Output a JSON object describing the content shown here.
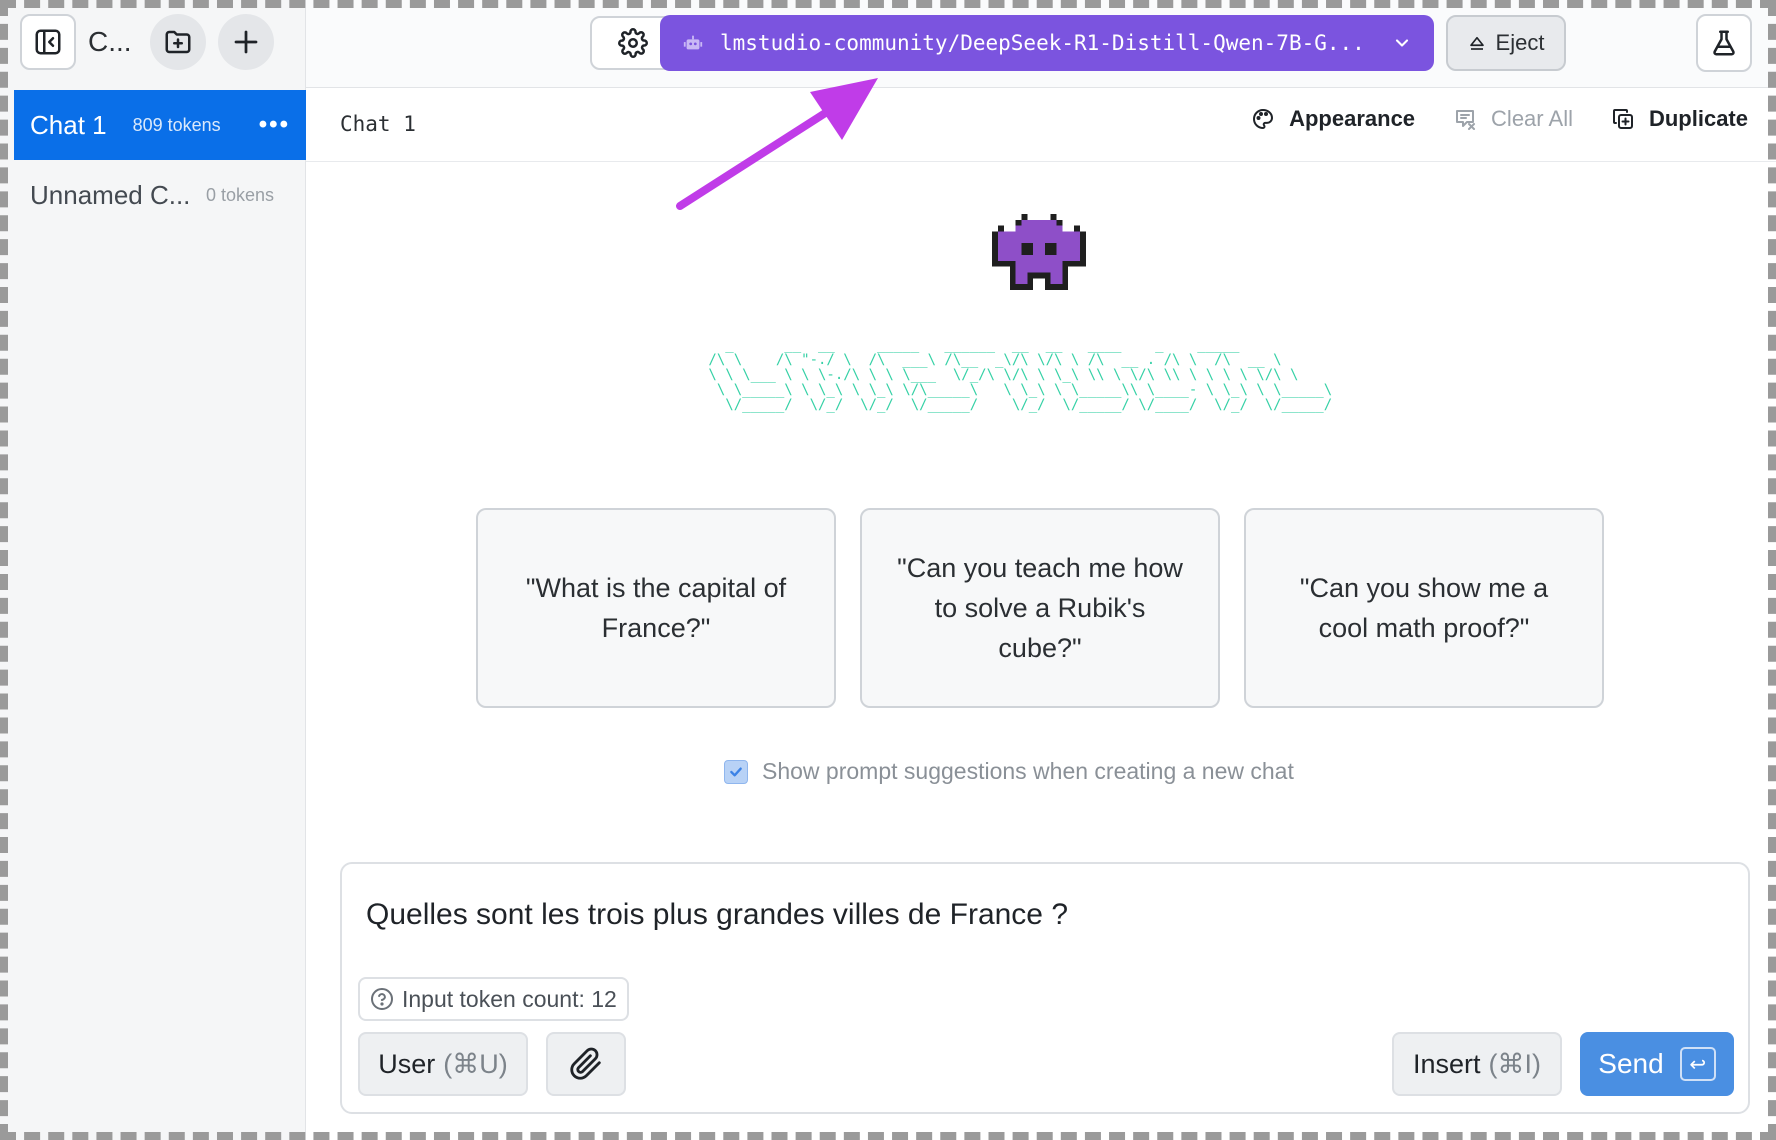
{
  "sidebar": {
    "title": "C...",
    "chats": [
      {
        "name": "Chat 1",
        "tokens": "809 tokens",
        "menu": "•••"
      },
      {
        "name": "Unnamed C...",
        "tokens": "0 tokens"
      }
    ]
  },
  "topbar": {
    "model": "lmstudio-community/DeepSeek-R1-Distill-Qwen-7B-G...",
    "eject_label": "Eject"
  },
  "chat_header": {
    "title": "Chat 1",
    "appearance_label": "Appearance",
    "clear_all_label": "Clear All",
    "duplicate_label": "Duplicate"
  },
  "ascii_art": "   _      __  __     _____   ______  __  __   ____    _    _____\n /\\ \\    /\\ \"-./ \\  /\\  ___\\ /\\__  _\\/\\ \\/\\ \\ /\\  __ . /\\ \\  /\\  __ \\\n \\ \\ \\___ \\ \\ \\-./\\ \\ \\ \\___  \\/_/\\ \\/\\ \\ \\_\\ \\\\ \\ \\/\\ \\\\ \\ \\ \\ \\ \\/\\ \\\n  \\ \\_____\\ \\ \\_\\ \\ \\_\\ \\/\\_____\\   \\ \\_\\ \\ \\_____\\\\ \\____- \\ \\_\\ \\ \\_____\\\n   \\/_____/  \\/_/  \\/_/  \\/_____/    \\/_/  \\/_____/ \\/____/  \\/_/  \\/_____/",
  "suggestions": [
    "\"What is the capital of France?\"",
    "\"Can you teach me how to solve a Rubik's cube?\"",
    "\"Can you show me a cool math proof?\""
  ],
  "show_suggestions_label": "Show prompt suggestions when creating a new chat",
  "show_suggestions_checked": true,
  "composer": {
    "text": "Quelles sont les trois plus grandes villes de France ?",
    "token_count": "Input token count: 12",
    "role_label": "User",
    "role_shortcut": "(⌘U)",
    "insert_label": "Insert",
    "insert_shortcut": "(⌘I)",
    "send_label": "Send",
    "send_key": "↩"
  },
  "colors": {
    "accent": "#0a6fe8",
    "model_button": "#7b54df",
    "send_button": "#4a8fe2",
    "ascii_text": "#36d1a6",
    "arrow": "#c03ce8"
  }
}
